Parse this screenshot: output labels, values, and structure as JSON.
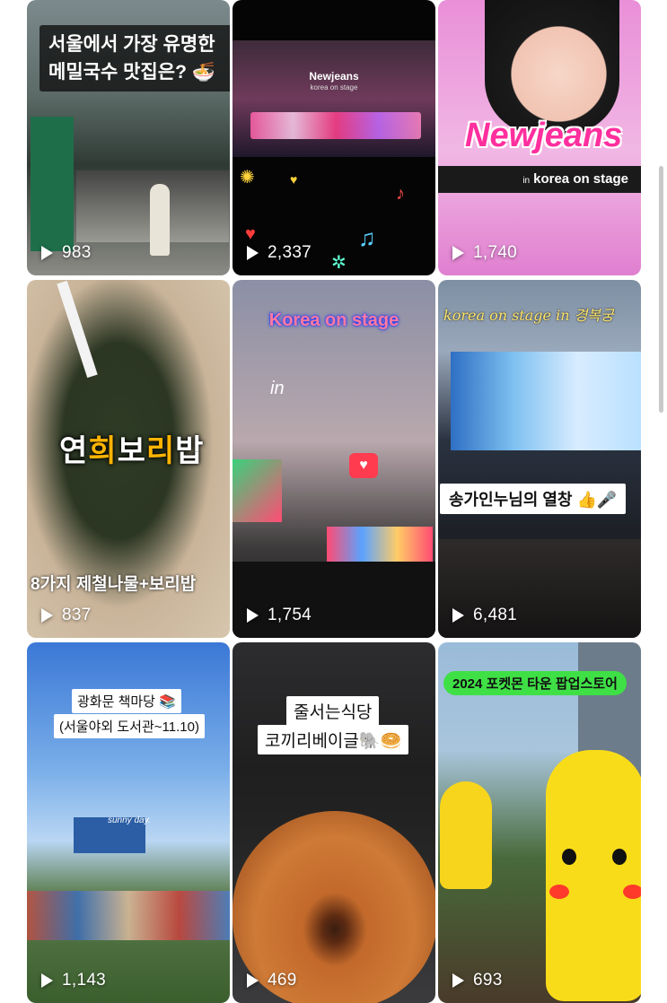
{
  "grid": {
    "tiles": [
      {
        "id": "t1",
        "views": "983",
        "caption_line1": "서울에서 가장 유명한",
        "caption_line2": "메밀국수 맛집은? 🍜"
      },
      {
        "id": "t2",
        "views": "2,337",
        "stage_title": "Newjeans",
        "stage_sub": "korea on stage"
      },
      {
        "id": "t3",
        "views": "1,740",
        "brand": "Newjeans",
        "band_prefix": "in",
        "band_text": "korea on stage"
      },
      {
        "id": "t4",
        "views": "837",
        "title_1": "연",
        "title_2": "희",
        "title_3": "보",
        "title_4": "리",
        "title_5": "밥",
        "subtitle": "8가지 제철나물+보리밥"
      },
      {
        "id": "t5",
        "views": "1,754",
        "title": "Korea on stage",
        "in_text": "in"
      },
      {
        "id": "t6",
        "views": "6,481",
        "title": "korea on stage in 경복궁",
        "tag": "송가인누님의 열창 👍🎤"
      },
      {
        "id": "t7",
        "views": "1,143",
        "label1": "광화문 책마당 📚",
        "label2": "(서울야외 도서관~11.10)",
        "sunny": "sunny day."
      },
      {
        "id": "t8",
        "views": "469",
        "label1": "줄서는식당",
        "label2": "코끼리베이글🐘🥯"
      },
      {
        "id": "t9",
        "views": "693",
        "badge": "2024 포켓몬 타운 팝업스토어"
      }
    ]
  },
  "icons": {
    "play": "play-icon",
    "heart": "heart-icon"
  },
  "colors": {
    "background": "#ffffff",
    "pink_brand": "#ff2f9e",
    "badge_green": "#3fe046",
    "title_orange": "#ffb400"
  }
}
